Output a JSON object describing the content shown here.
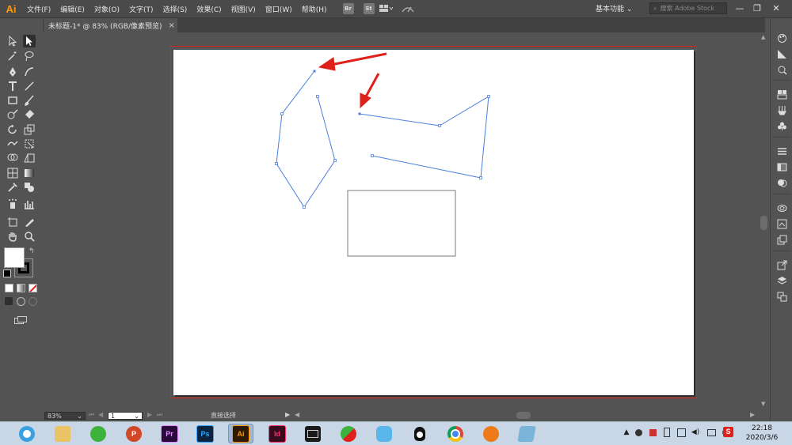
{
  "app": {
    "logo": "Ai",
    "brand_color": "#ff9a00"
  },
  "menu": {
    "items": [
      "文件(F)",
      "编辑(E)",
      "对象(O)",
      "文字(T)",
      "选择(S)",
      "效果(C)",
      "视图(V)",
      "窗口(W)",
      "帮助(H)"
    ],
    "bridge_label": "Br",
    "stock_label": "St",
    "workspace": "基本功能 ⌄",
    "search_placeholder": "搜索 Adobe Stock"
  },
  "document": {
    "tab_title": "未标题-1* @ 83% (RGB/像素预览)",
    "close_glyph": "×"
  },
  "status": {
    "zoom": "83%",
    "page": "1",
    "tool_name": "直接选择"
  },
  "taskbar": {
    "apps": [
      {
        "name": "browser-360",
        "label": "",
        "color": "#3aa0e0"
      },
      {
        "name": "file-explorer",
        "label": "",
        "color": "#e9c464"
      },
      {
        "name": "wechat",
        "label": "",
        "color": "#3db23d"
      },
      {
        "name": "powerpoint",
        "label": "P",
        "color": "#d24726"
      },
      {
        "name": "premiere",
        "label": "Pr",
        "color": "#2a0a3a"
      },
      {
        "name": "photoshop",
        "label": "Ps",
        "color": "#0a2440"
      },
      {
        "name": "illustrator",
        "label": "Ai",
        "color": "#2e1a00"
      },
      {
        "name": "indesign",
        "label": "Id",
        "color": "#3a0a1e"
      },
      {
        "name": "video-player",
        "label": "",
        "color": "#1a1a1a"
      },
      {
        "name": "app-green-red",
        "label": "",
        "color": "#e8e8e8"
      },
      {
        "name": "app-blue-bird",
        "label": "",
        "color": "#58b6ea"
      },
      {
        "name": "qq",
        "label": "",
        "color": "#111"
      },
      {
        "name": "chrome",
        "label": "",
        "color": "#e8e8e8"
      },
      {
        "name": "app-orange",
        "label": "",
        "color": "#ee7a1a"
      },
      {
        "name": "app-notebook",
        "label": "",
        "color": "#7ab4d8"
      }
    ],
    "time": "22:18",
    "date": "2020/3/6"
  },
  "colors": {
    "path_blue": "#4a7fe0",
    "arrow_red": "#e0201a",
    "rect_stroke": "#7a7a7a"
  }
}
